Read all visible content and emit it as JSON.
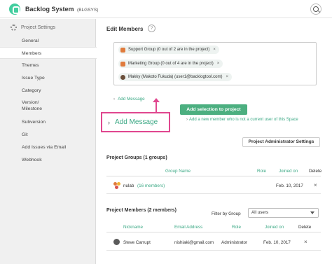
{
  "header": {
    "app_title": "Backlog System",
    "project_key": "(BLGSYS)",
    "logo_icon": "backlog-logo-icon",
    "search_icon": "search-icon"
  },
  "sidebar": {
    "heading": "Project Settings",
    "items": [
      {
        "label": "General"
      },
      {
        "label": "Members"
      },
      {
        "label": "Themes"
      },
      {
        "label": "Issue Type"
      },
      {
        "label": "Category"
      },
      {
        "label": "Version/ Milestone"
      },
      {
        "label": "Subversion"
      },
      {
        "label": "Git"
      },
      {
        "label": "Add Issues via Email"
      },
      {
        "label": "Webhook"
      }
    ],
    "active_item": "Members"
  },
  "edit_members": {
    "title": "Edit Members",
    "help_symbol": "?",
    "selected": [
      {
        "label": "Support Group (0 out of 2 are in the project)",
        "icon": "group-icon"
      },
      {
        "label": "Marketing Group (0 out of 4 are in the project)",
        "icon": "group-icon"
      },
      {
        "label": "Makky (Makoto Fukuda) (user1@backlogtool.com)",
        "icon": "avatar-icon"
      }
    ],
    "remove_symbol": "×",
    "add_message_small": "Add Message",
    "add_message_callout": "Add Message",
    "add_selection_button": "Add selection to project",
    "new_member_link": "Add a new member who is not a current user of this Space",
    "admin_settings_button": "Project Administrator Settings"
  },
  "project_groups": {
    "title": "Project Groups (1 groups)",
    "columns": [
      "Group Name",
      "Role",
      "Joined on",
      "Delete"
    ],
    "rows": [
      {
        "name": "nulab",
        "members": "(16 members)",
        "role": "",
        "joined": "Feb. 10, 2017",
        "delete": "×"
      }
    ]
  },
  "project_members": {
    "title": "Project Members (2 members)",
    "filter_label": "Filter by Group",
    "filter_value": "All users",
    "columns": [
      "Nickname",
      "Email Address",
      "Role",
      "Joined on",
      "Delete"
    ],
    "rows": [
      {
        "nickname": "Steve Carrupt",
        "email": "nishiaki@gmail.com",
        "role": "Administrator",
        "joined": "Feb. 10, 2017",
        "delete": "×"
      }
    ]
  },
  "colors": {
    "accent_green": "#3aa884",
    "button_green": "#4caf80",
    "callout_pink": "#e0478f"
  }
}
